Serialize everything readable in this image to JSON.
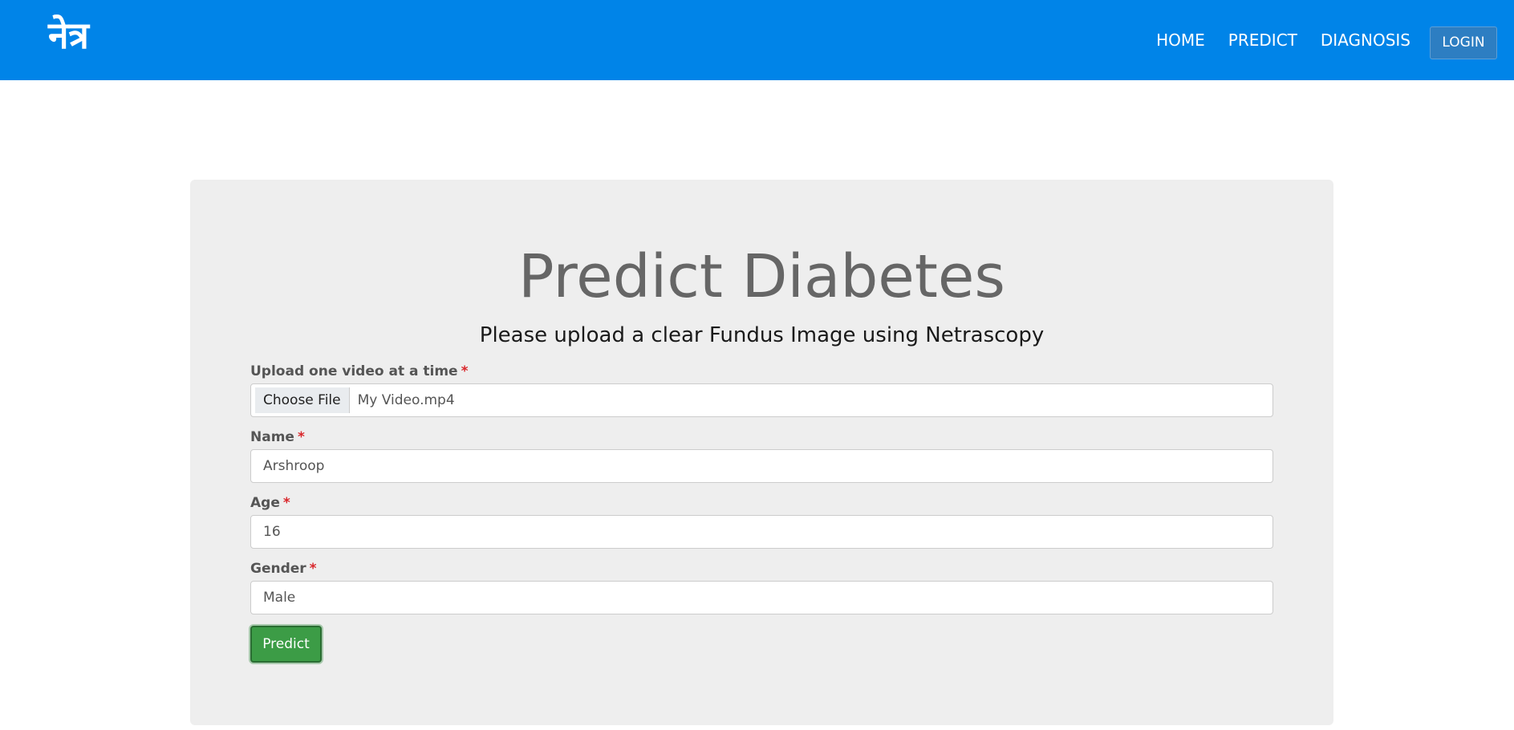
{
  "navbar": {
    "brand": "नेत्र",
    "links": [
      "HOME",
      "PREDICT",
      "DIAGNOSIS"
    ],
    "login_label": "LOGIN",
    "color": "#0084e8"
  },
  "main": {
    "title": "Predict Diabetes",
    "subtitle": "Please upload a clear Fundus Image using Netrascopy",
    "form": {
      "upload": {
        "label": "Upload one video at a time",
        "required": "*",
        "button_label": "Choose File",
        "file_name": "My Video.mp4"
      },
      "name": {
        "label": "Name",
        "required": "*",
        "value": "Arshroop"
      },
      "age": {
        "label": "Age",
        "required": "*",
        "value": "16"
      },
      "gender": {
        "label": "Gender",
        "required": "*",
        "value": "Male"
      },
      "submit_label": "Predict",
      "submit_color": "#3c9c46"
    }
  }
}
